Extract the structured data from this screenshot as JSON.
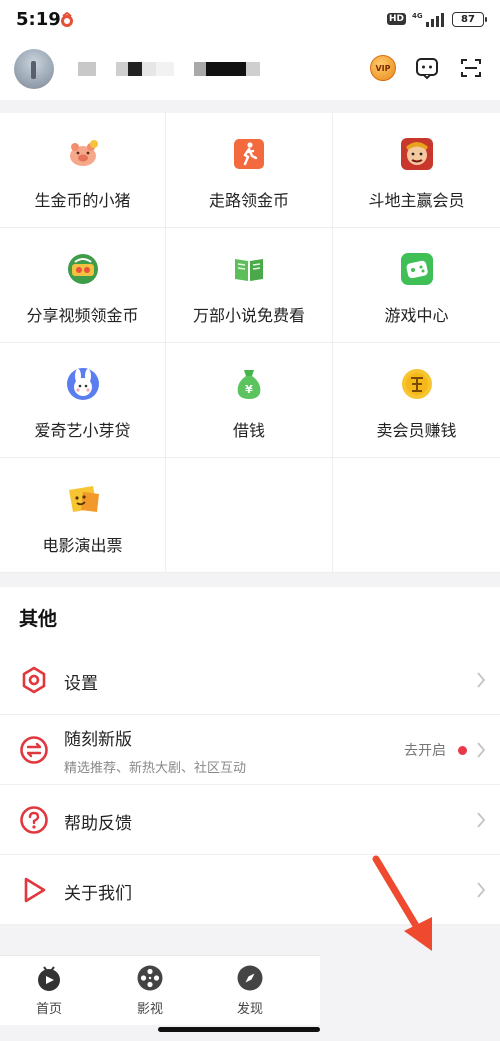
{
  "status_bar": {
    "time": "5:19",
    "hd_badge": "HD",
    "network": "4G",
    "battery": "87"
  },
  "header": {
    "avatar_icon": "avatar-photo",
    "username_redacted": true,
    "vip_label": "VIP",
    "message_icon": "message-icon",
    "scan_icon": "scan-icon"
  },
  "services": [
    {
      "label": "生金币的小猪",
      "icon": "piggy-icon"
    },
    {
      "label": "走路领金币",
      "icon": "walking-icon"
    },
    {
      "label": "斗地主赢会员",
      "icon": "landlord-game-icon"
    },
    {
      "label": "分享视频领金币",
      "icon": "share-video-icon"
    },
    {
      "label": "万部小说免费看",
      "icon": "book-icon"
    },
    {
      "label": "游戏中心",
      "icon": "game-center-icon"
    },
    {
      "label": "爱奇艺小芽贷",
      "icon": "rabbit-icon"
    },
    {
      "label": "借钱",
      "icon": "money-bag-icon"
    },
    {
      "label": "卖会员赚钱",
      "icon": "earn-coin-icon"
    },
    {
      "label": "电影演出票",
      "icon": "ticket-icon"
    }
  ],
  "other": {
    "title": "其他",
    "items": [
      {
        "label": "设置",
        "icon": "settings-icon"
      },
      {
        "label": "随刻新版",
        "sub": "精选推荐、新热大剧、社区互动",
        "status": "去开启",
        "icon": "swap-icon"
      },
      {
        "label": "帮助反馈",
        "icon": "help-icon"
      },
      {
        "label": "关于我们",
        "icon": "play-outline-icon"
      }
    ]
  },
  "bottom_nav": [
    {
      "label": "首页",
      "icon": "home-tv-icon"
    },
    {
      "label": "影视",
      "icon": "film-reel-icon"
    },
    {
      "label": "发现",
      "icon": "compass-icon"
    }
  ],
  "colors": {
    "accent_red": "#e0383e",
    "dot_red": "#e8384a",
    "annotation_arrow": "#ef4a2f"
  }
}
